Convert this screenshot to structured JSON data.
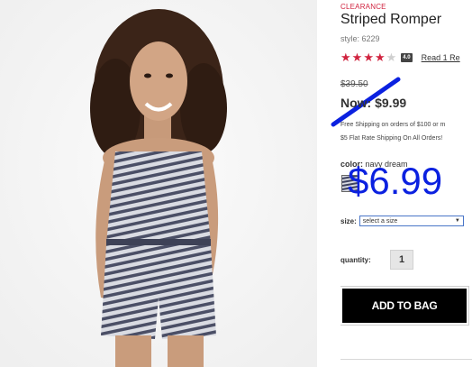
{
  "product": {
    "badge": "CLEARANCE",
    "title": "Striped Romper",
    "style": "style: 6229",
    "rating": {
      "value": 4,
      "max": 5,
      "badge": "4.0",
      "reviews_link": "Read 1 Re"
    }
  },
  "pricing": {
    "old_price": "$39.50",
    "now_price": "Now: $9.99",
    "overlay_new_price": "$6.99",
    "overlay_color": "#0b21e0",
    "accent_color": "#d0233f"
  },
  "shipping": {
    "line1": "Free Shipping on orders of $100 or m",
    "line2": "$5 Flat Rate Shipping On All Orders!"
  },
  "color": {
    "label": "color:",
    "value": "navy dream"
  },
  "size": {
    "label": "size:",
    "selected": "select a size"
  },
  "quantity": {
    "label": "quantity:",
    "value": "1"
  },
  "cart": {
    "button_label": "ADD TO BAG"
  }
}
